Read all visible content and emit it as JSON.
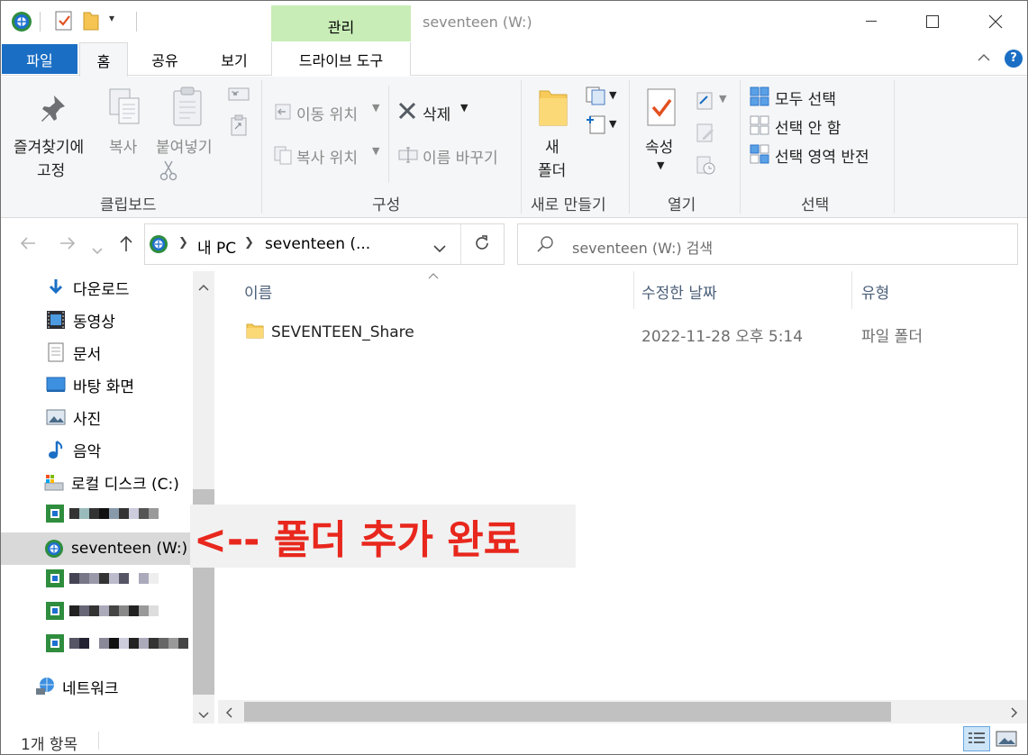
{
  "window": {
    "title": "seventeen (W:)",
    "context_tab": "관리"
  },
  "tabs": [
    "파일",
    "홈",
    "공유",
    "보기",
    "드라이브 도구"
  ],
  "ribbon": {
    "clipboard": {
      "group": "클립보드",
      "pin_line1": "즐겨찾기에",
      "pin_line2": "고정",
      "copy": "복사",
      "paste": "붙여넣기"
    },
    "organize": {
      "group": "구성",
      "move_to": "이동 위치",
      "copy_to": "복사 위치",
      "delete": "삭제",
      "rename": "이름 바꾸기"
    },
    "new": {
      "group": "새로 만들기",
      "folder_line1": "새",
      "folder_line2": "폴더"
    },
    "open": {
      "group": "열기",
      "properties": "속성"
    },
    "select": {
      "group": "선택",
      "select_all": "모두 선택",
      "select_none": "선택 안 함",
      "invert": "선택 영역 반전"
    }
  },
  "address": {
    "crumb1": "내 PC",
    "crumb2": "seventeen (...",
    "search_placeholder": "seventeen (W:) 검색"
  },
  "nav": {
    "items": [
      {
        "label": "다운로드",
        "icon": "download-icon"
      },
      {
        "label": "동영상",
        "icon": "video-icon"
      },
      {
        "label": "문서",
        "icon": "document-icon"
      },
      {
        "label": "바탕 화면",
        "icon": "desktop-icon"
      },
      {
        "label": "사진",
        "icon": "picture-icon"
      },
      {
        "label": "음악",
        "icon": "music-icon"
      },
      {
        "label": "로컬 디스크 (C:)",
        "icon": "local-disk-icon"
      },
      {
        "label": "seventeen (W:)",
        "icon": "network-drive-icon"
      },
      {
        "label": "네트워크",
        "icon": "network-icon"
      }
    ]
  },
  "list": {
    "columns": [
      "이름",
      "수정한 날짜",
      "유형"
    ],
    "rows": [
      {
        "name": "SEVENTEEN_Share",
        "modified": "2022-11-28 오후 5:14",
        "type": "파일 폴더"
      }
    ]
  },
  "annotation": "<-- 폴더 추가 완료",
  "status": {
    "item_count": "1개 항목"
  },
  "colors": {
    "accent": "#1a6ec4",
    "context_tab": "#c8edb7",
    "annotation": "#e8271d",
    "selection": "#d9d9d9"
  }
}
